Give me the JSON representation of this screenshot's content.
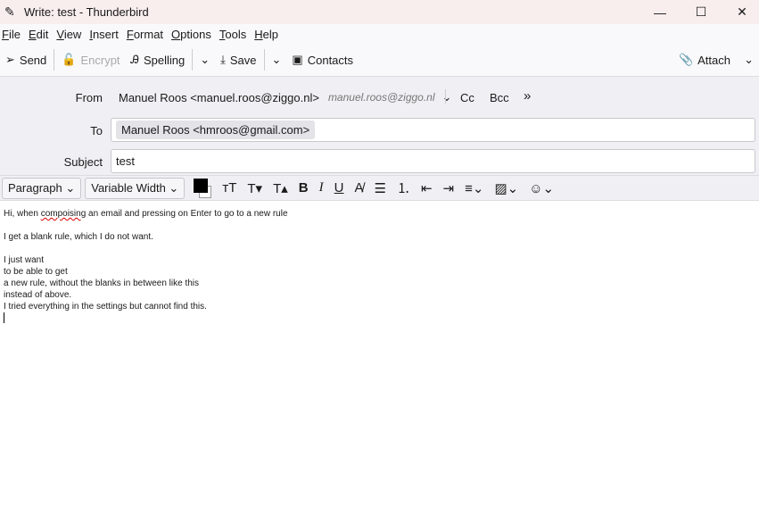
{
  "window": {
    "title": "Write: test - Thunderbird",
    "minimize": "—",
    "maximize": "☐",
    "close": "✕"
  },
  "menu": [
    "File",
    "Edit",
    "View",
    "Insert",
    "Format",
    "Options",
    "Tools",
    "Help"
  ],
  "toolbar": {
    "send": "Send",
    "encrypt": "Encrypt",
    "spelling": "Spelling",
    "save": "Save",
    "contacts": "Contacts",
    "attach": "Attach"
  },
  "headers": {
    "from_label": "From",
    "from_value": "Manuel Roos <manuel.roos@ziggo.nl>",
    "from_identity": "manuel.roos@ziggo.nl",
    "cc": "Cc",
    "bcc": "Bcc",
    "to_label": "To",
    "to_recipient": "Manuel Roos <hmroos@gmail.com>",
    "subject_label": "Subject",
    "subject_value": "test"
  },
  "format": {
    "paragraph": "Paragraph",
    "font": "Variable Width",
    "text_color": "#000000"
  },
  "body": {
    "line1a": "Hi, when ",
    "line1b": "compoising",
    "line1c": " an email and pressing on Enter to go to a new rule",
    "lines": [
      "",
      "I get a blank rule, which I do not want.",
      "",
      "I just want",
      "to be able to get",
      "a new rule, without the blanks in between like this",
      "instead of above.",
      "I tried everything in the settings but cannot find this."
    ]
  }
}
